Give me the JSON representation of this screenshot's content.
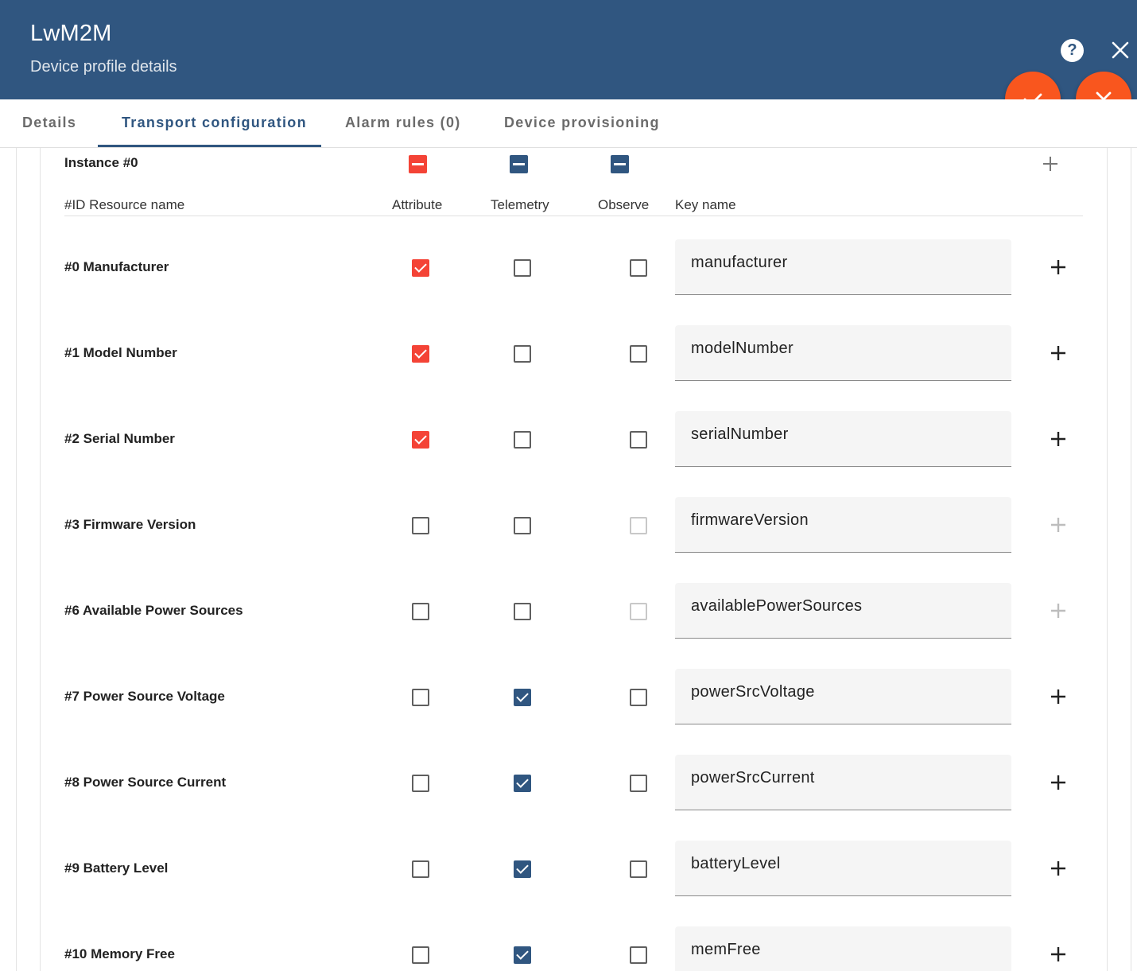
{
  "header": {
    "title": "LwM2M",
    "subtitle": "Device profile details",
    "help_label": "?",
    "bg_color": "#305680",
    "fab_color": "#f9561e"
  },
  "tabs": [
    {
      "label": "Details"
    },
    {
      "label": "Transport configuration"
    },
    {
      "label": "Alarm rules (0)"
    },
    {
      "label": "Device provisioning"
    }
  ],
  "active_tab": "Transport configuration",
  "instance": {
    "label": "Instance #0",
    "columns": {
      "id_name": "#ID Resource name",
      "attribute": "Attribute",
      "telemetry": "Telemetry",
      "observe": "Observe",
      "key_name": "Key name"
    }
  },
  "resources": [
    {
      "name": "#0 Manufacturer",
      "attribute": true,
      "telemetry": false,
      "observe": false,
      "observe_disabled": false,
      "key": "manufacturer",
      "add_disabled": false
    },
    {
      "name": "#1 Model Number",
      "attribute": true,
      "telemetry": false,
      "observe": false,
      "observe_disabled": false,
      "key": "modelNumber",
      "add_disabled": false
    },
    {
      "name": "#2 Serial Number",
      "attribute": true,
      "telemetry": false,
      "observe": false,
      "observe_disabled": false,
      "key": "serialNumber",
      "add_disabled": false
    },
    {
      "name": "#3 Firmware Version",
      "attribute": false,
      "telemetry": false,
      "observe": false,
      "observe_disabled": true,
      "key": "firmwareVersion",
      "add_disabled": true
    },
    {
      "name": "#6 Available Power Sources",
      "attribute": false,
      "telemetry": false,
      "observe": false,
      "observe_disabled": true,
      "key": "availablePowerSources",
      "add_disabled": true
    },
    {
      "name": "#7 Power Source Voltage",
      "attribute": false,
      "telemetry": true,
      "observe": false,
      "observe_disabled": false,
      "key": "powerSrcVoltage",
      "add_disabled": false
    },
    {
      "name": "#8 Power Source Current",
      "attribute": false,
      "telemetry": true,
      "observe": false,
      "observe_disabled": false,
      "key": "powerSrcCurrent",
      "add_disabled": false
    },
    {
      "name": "#9 Battery Level",
      "attribute": false,
      "telemetry": true,
      "observe": false,
      "observe_disabled": false,
      "key": "batteryLevel",
      "add_disabled": false
    },
    {
      "name": "#10 Memory Free",
      "attribute": false,
      "telemetry": true,
      "observe": false,
      "observe_disabled": false,
      "key": "memFree",
      "add_disabled": false
    }
  ],
  "colors": {
    "attribute_checked": "#f44336",
    "telemetry_checked": "#305680",
    "observe_checked": "#305680"
  }
}
